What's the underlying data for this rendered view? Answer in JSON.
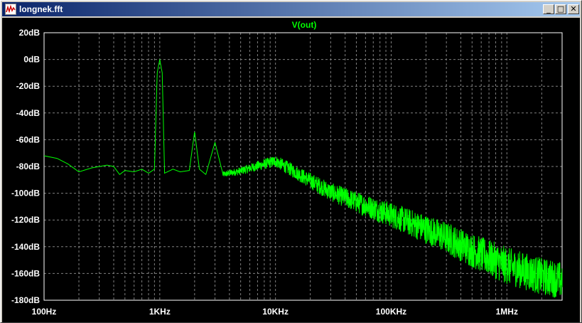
{
  "window": {
    "title": "longnek.fft",
    "buttons": {
      "minimize": "_",
      "maximize": "□",
      "close": "✕"
    },
    "icons": {
      "app": "waveform-icon"
    }
  },
  "colors": {
    "background": "#000000",
    "trace": "#00ff00",
    "grid": "#808080",
    "labels": "#ffffff",
    "titlebar": "#0a246a"
  },
  "chart_data": {
    "type": "line",
    "title": "V(out)",
    "xlabel": "",
    "ylabel": "",
    "x_scale": "log",
    "xlim_hz": [
      100,
      3000000
    ],
    "ylim_db": [
      -180,
      20
    ],
    "x_ticks": [
      "100Hz",
      "1KHz",
      "10KHz",
      "100KHz",
      "1MHz"
    ],
    "y_ticks": [
      "20dB",
      "0dB",
      "-20dB",
      "-40dB",
      "-60dB",
      "-80dB",
      "-100dB",
      "-120dB",
      "-140dB",
      "-160dB",
      "-180dB"
    ],
    "grid": true,
    "series": [
      {
        "name": "V(out)",
        "points_hz_db": [
          [
            100,
            -72
          ],
          [
            130,
            -74
          ],
          [
            160,
            -78
          ],
          [
            200,
            -84
          ],
          [
            260,
            -81
          ],
          [
            350,
            -79
          ],
          [
            400,
            -80
          ],
          [
            450,
            -86
          ],
          [
            500,
            -83
          ],
          [
            600,
            -84
          ],
          [
            700,
            -82
          ],
          [
            800,
            -85
          ],
          [
            900,
            -82
          ],
          [
            950,
            -10
          ],
          [
            1000,
            0
          ],
          [
            1050,
            -10
          ],
          [
            1100,
            -85
          ],
          [
            1300,
            -82
          ],
          [
            1500,
            -84
          ],
          [
            1800,
            -83
          ],
          [
            2000,
            -54
          ],
          [
            2200,
            -82
          ],
          [
            2500,
            -86
          ],
          [
            3000,
            -62
          ],
          [
            3500,
            -85
          ],
          [
            5000,
            -82
          ],
          [
            7000,
            -78
          ],
          [
            10000,
            -74
          ],
          [
            15000,
            -82
          ],
          [
            20000,
            -88
          ],
          [
            30000,
            -96
          ],
          [
            50000,
            -103
          ],
          [
            100000,
            -112
          ],
          [
            200000,
            -122
          ],
          [
            300000,
            -128
          ],
          [
            500000,
            -137
          ],
          [
            1000000,
            -148
          ],
          [
            2000000,
            -156
          ],
          [
            3000000,
            -159
          ]
        ]
      }
    ]
  }
}
